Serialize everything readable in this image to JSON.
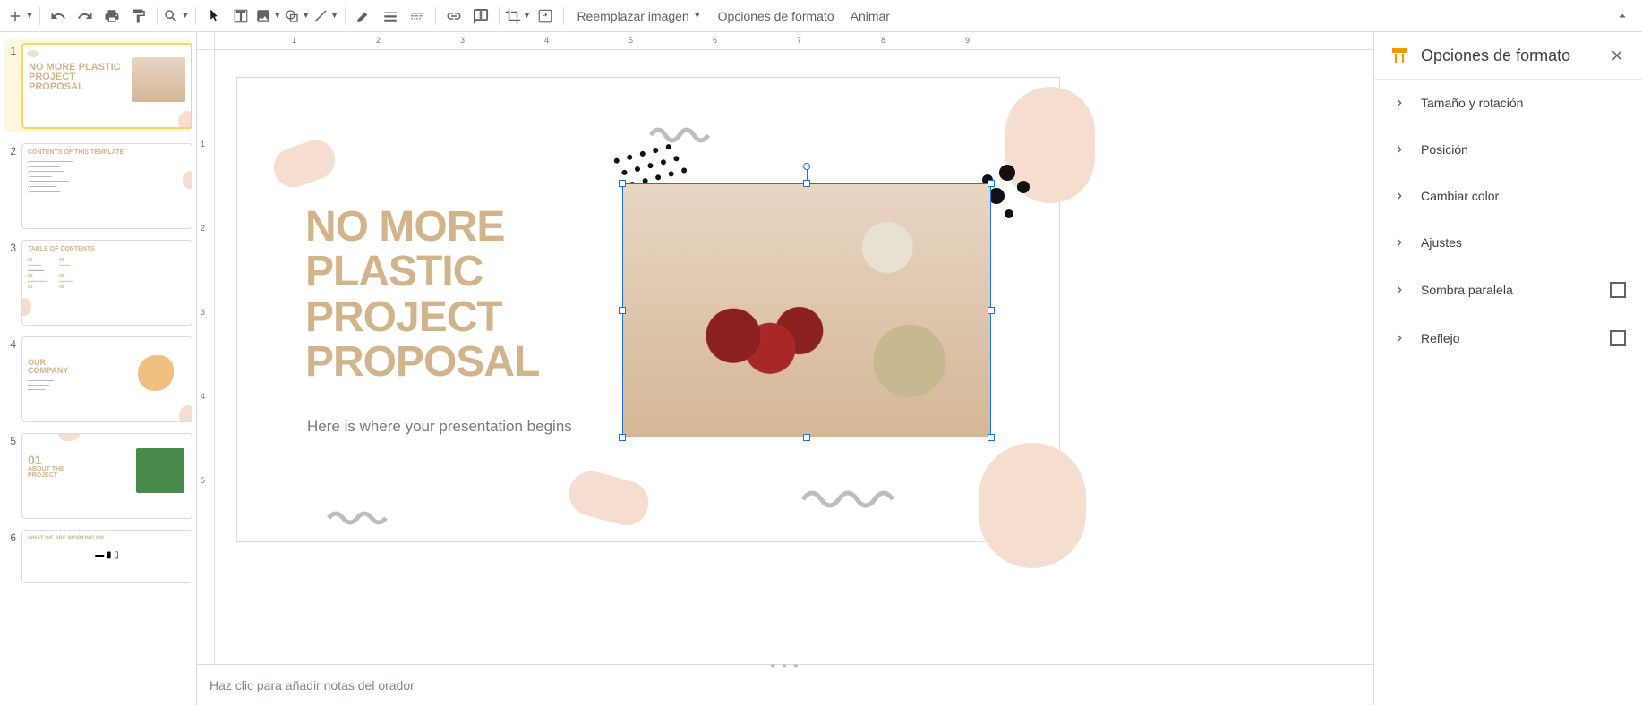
{
  "toolbar": {
    "replace_image": "Reemplazar imagen",
    "format_options": "Opciones de formato",
    "animate": "Animar"
  },
  "slide": {
    "title_line1": "NO MORE",
    "title_line2": "PLASTIC",
    "title_line3": "PROJECT",
    "title_line4": "PROPOSAL",
    "subtitle": "Here is where your presentation begins"
  },
  "notes": {
    "placeholder": "Haz clic para añadir notas del orador"
  },
  "sidebar": {
    "title": "Opciones de formato",
    "sections": {
      "size_rotation": "Tamaño y rotación",
      "position": "Posición",
      "recolor": "Cambiar color",
      "adjustments": "Ajustes",
      "drop_shadow": "Sombra paralela",
      "reflection": "Reflejo"
    }
  },
  "thumbs": {
    "s1": "NO MORE PLASTIC PROJECT PROPOSAL",
    "s2": "CONTENTS OF THIS TEMPLATE",
    "s3": "TABLE OF CONTENTS",
    "s4a": "OUR",
    "s4b": "COMPANY",
    "s5a": "01",
    "s5b": "ABOUT THE",
    "s5c": "PROJECT",
    "s6": "WHAT WE ARE WORKING ON"
  },
  "ruler_h": [
    "1",
    "2",
    "3",
    "4",
    "5",
    "6",
    "7",
    "8",
    "9"
  ],
  "ruler_v": [
    "1",
    "2",
    "3",
    "4",
    "5"
  ]
}
